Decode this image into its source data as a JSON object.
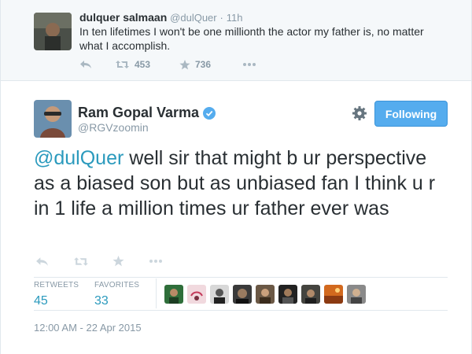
{
  "reply_to": {
    "name": "dulquer salmaan",
    "handle": "@dulQuer",
    "separator": "·",
    "time": "11h",
    "text": "In ten lifetimes I won't be one millionth the actor my father is, no matter what I accomplish.",
    "retweet_count": "453",
    "favorite_count": "736",
    "icons": [
      "reply-icon",
      "retweet-icon",
      "favorite-icon",
      "more-icon"
    ]
  },
  "tweet": {
    "name": "Ram Gopal Varma",
    "handle": "@RGVzoomin",
    "mention": "@dulQuer",
    "text": " well sir that might b ur perspective as a biased son but as unbiased fan I think u r in 1 life a million times ur father ever was",
    "follow_label": "Following",
    "icons": [
      "reply-icon",
      "retweet-icon",
      "favorite-icon",
      "more-icon",
      "gear-icon",
      "verified-badge-icon"
    ],
    "stats": {
      "retweets_label": "RETWEETS",
      "retweets_value": "45",
      "favorites_label": "FAVORITES",
      "favorites_value": "33"
    },
    "timestamp": "12:00 AM - 22 Apr 2015"
  },
  "colors": {
    "link": "#2b9abd",
    "muted": "#8899a6",
    "button": "#55acee",
    "text": "#292f33",
    "parent_bg": "#f5f8fa"
  }
}
